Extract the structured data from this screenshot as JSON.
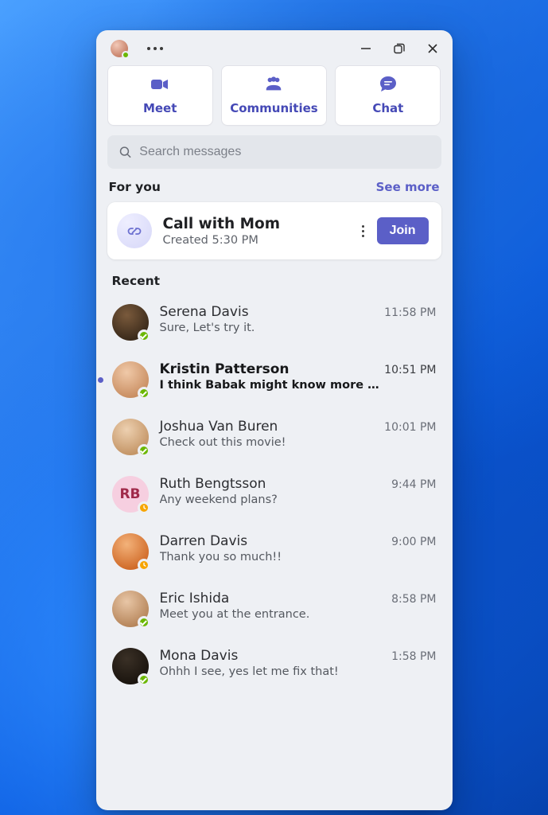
{
  "toolbar": {
    "meet": "Meet",
    "communities": "Communities",
    "chat": "Chat"
  },
  "search": {
    "placeholder": "Search messages"
  },
  "for_you": {
    "title": "For you",
    "see_more": "See more",
    "event": {
      "title": "Call with Mom",
      "subtitle": "Created 5:30 PM",
      "join": "Join"
    }
  },
  "recent": {
    "title": "Recent",
    "items": [
      {
        "name": "Serena Davis",
        "msg": "Sure, Let's try it.",
        "time": "11:58 PM",
        "presence": "available",
        "initials": "",
        "unread": false,
        "faceClass": "f1"
      },
      {
        "name": "Kristin Patterson",
        "msg": "I think Babak might know more a…",
        "time": "10:51 PM",
        "presence": "available",
        "initials": "",
        "unread": true,
        "faceClass": "f2"
      },
      {
        "name": "Joshua Van Buren",
        "msg": "Check out this movie!",
        "time": "10:01 PM",
        "presence": "available",
        "initials": "",
        "unread": false,
        "faceClass": "f3"
      },
      {
        "name": "Ruth Bengtsson",
        "msg": "Any weekend plans?",
        "time": "9:44 PM",
        "presence": "away",
        "initials": "RB",
        "unread": false,
        "faceClass": "f4"
      },
      {
        "name": "Darren Davis",
        "msg": "Thank you so much!!",
        "time": "9:00 PM",
        "presence": "away",
        "initials": "",
        "unread": false,
        "faceClass": "f5"
      },
      {
        "name": "Eric Ishida",
        "msg": "Meet you at the entrance.",
        "time": "8:58 PM",
        "presence": "available",
        "initials": "",
        "unread": false,
        "faceClass": "f6"
      },
      {
        "name": "Mona Davis",
        "msg": "Ohhh I see, yes let me fix that!",
        "time": "1:58 PM",
        "presence": "available",
        "initials": "",
        "unread": false,
        "faceClass": "f7"
      }
    ]
  }
}
